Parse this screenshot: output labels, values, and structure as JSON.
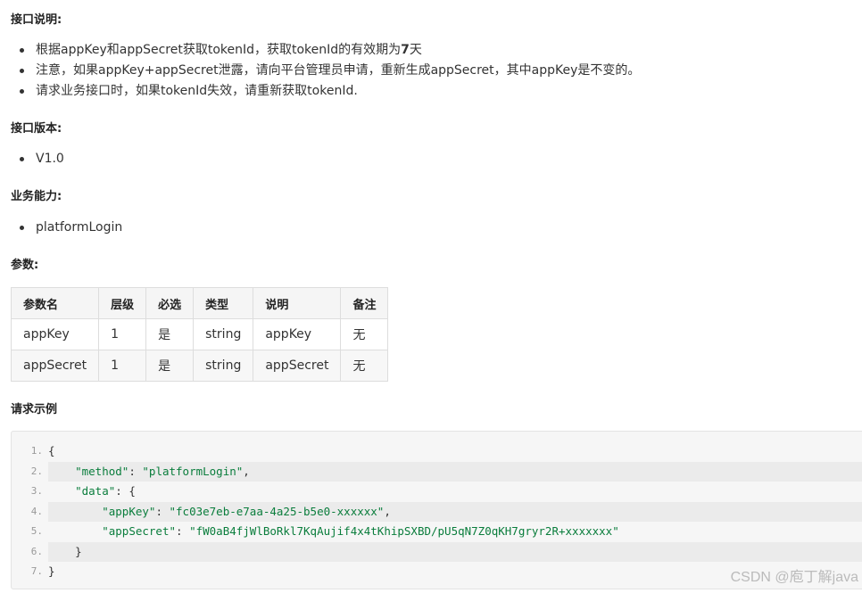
{
  "sections": {
    "desc_heading": "接口说明:",
    "desc_items": [
      [
        "根据appKey和appSecret获取tokenId，获取tokenId的有效期为",
        "7",
        "天"
      ],
      "注意，如果appKey+appSecret泄露，请向平台管理员申请，重新生成appSecret，其中appKey是不变的。",
      "请求业务接口时，如果tokenId失效，请重新获取tokenId."
    ],
    "version_heading": "接口版本:",
    "version_value": "V1.0",
    "capability_heading": "业务能力:",
    "capability_value": "platformLogin",
    "params_heading": "参数:",
    "example_heading": "请求示例"
  },
  "params_table": {
    "headers": [
      "参数名",
      "层级",
      "必选",
      "类型",
      "说明",
      "备注"
    ],
    "rows": [
      [
        "appKey",
        "1",
        "是",
        "string",
        "appKey",
        "无"
      ],
      [
        "appSecret",
        "1",
        "是",
        "string",
        "appSecret",
        "无"
      ]
    ]
  },
  "code_example": {
    "line_numbers": [
      "1.",
      "2.",
      "3.",
      "4.",
      "5.",
      "6.",
      "7."
    ],
    "lines": [
      {
        "indent": "",
        "parts": [
          {
            "t": "p",
            "v": "{"
          }
        ]
      },
      {
        "indent": "    ",
        "parts": [
          {
            "t": "k",
            "v": "\"method\""
          },
          {
            "t": "p",
            "v": ": "
          },
          {
            "t": "s",
            "v": "\"platformLogin\""
          },
          {
            "t": "p",
            "v": ","
          }
        ]
      },
      {
        "indent": "    ",
        "parts": [
          {
            "t": "k",
            "v": "\"data\""
          },
          {
            "t": "p",
            "v": ": {"
          }
        ]
      },
      {
        "indent": "        ",
        "parts": [
          {
            "t": "k",
            "v": "\"appKey\""
          },
          {
            "t": "p",
            "v": ": "
          },
          {
            "t": "s",
            "v": "\"fc03e7eb-e7aa-4a25-b5e0-xxxxxx\""
          },
          {
            "t": "p",
            "v": ","
          }
        ]
      },
      {
        "indent": "        ",
        "parts": [
          {
            "t": "k",
            "v": "\"appSecret\""
          },
          {
            "t": "p",
            "v": ": "
          },
          {
            "t": "s",
            "v": "\"fW0aB4fjWlBoRkl7KqAujif4x4tKhipSXBD/pU5qN7Z0qKH7gryr2R+xxxxxxx\""
          }
        ]
      },
      {
        "indent": "    ",
        "parts": [
          {
            "t": "p",
            "v": "}"
          }
        ]
      },
      {
        "indent": "",
        "parts": [
          {
            "t": "p",
            "v": "}"
          }
        ]
      }
    ]
  },
  "watermark": "CSDN @庖丁解java",
  "colors": {
    "string": "#0a7d3c",
    "line_number": "#999999",
    "code_bg": "#f6f6f6"
  }
}
